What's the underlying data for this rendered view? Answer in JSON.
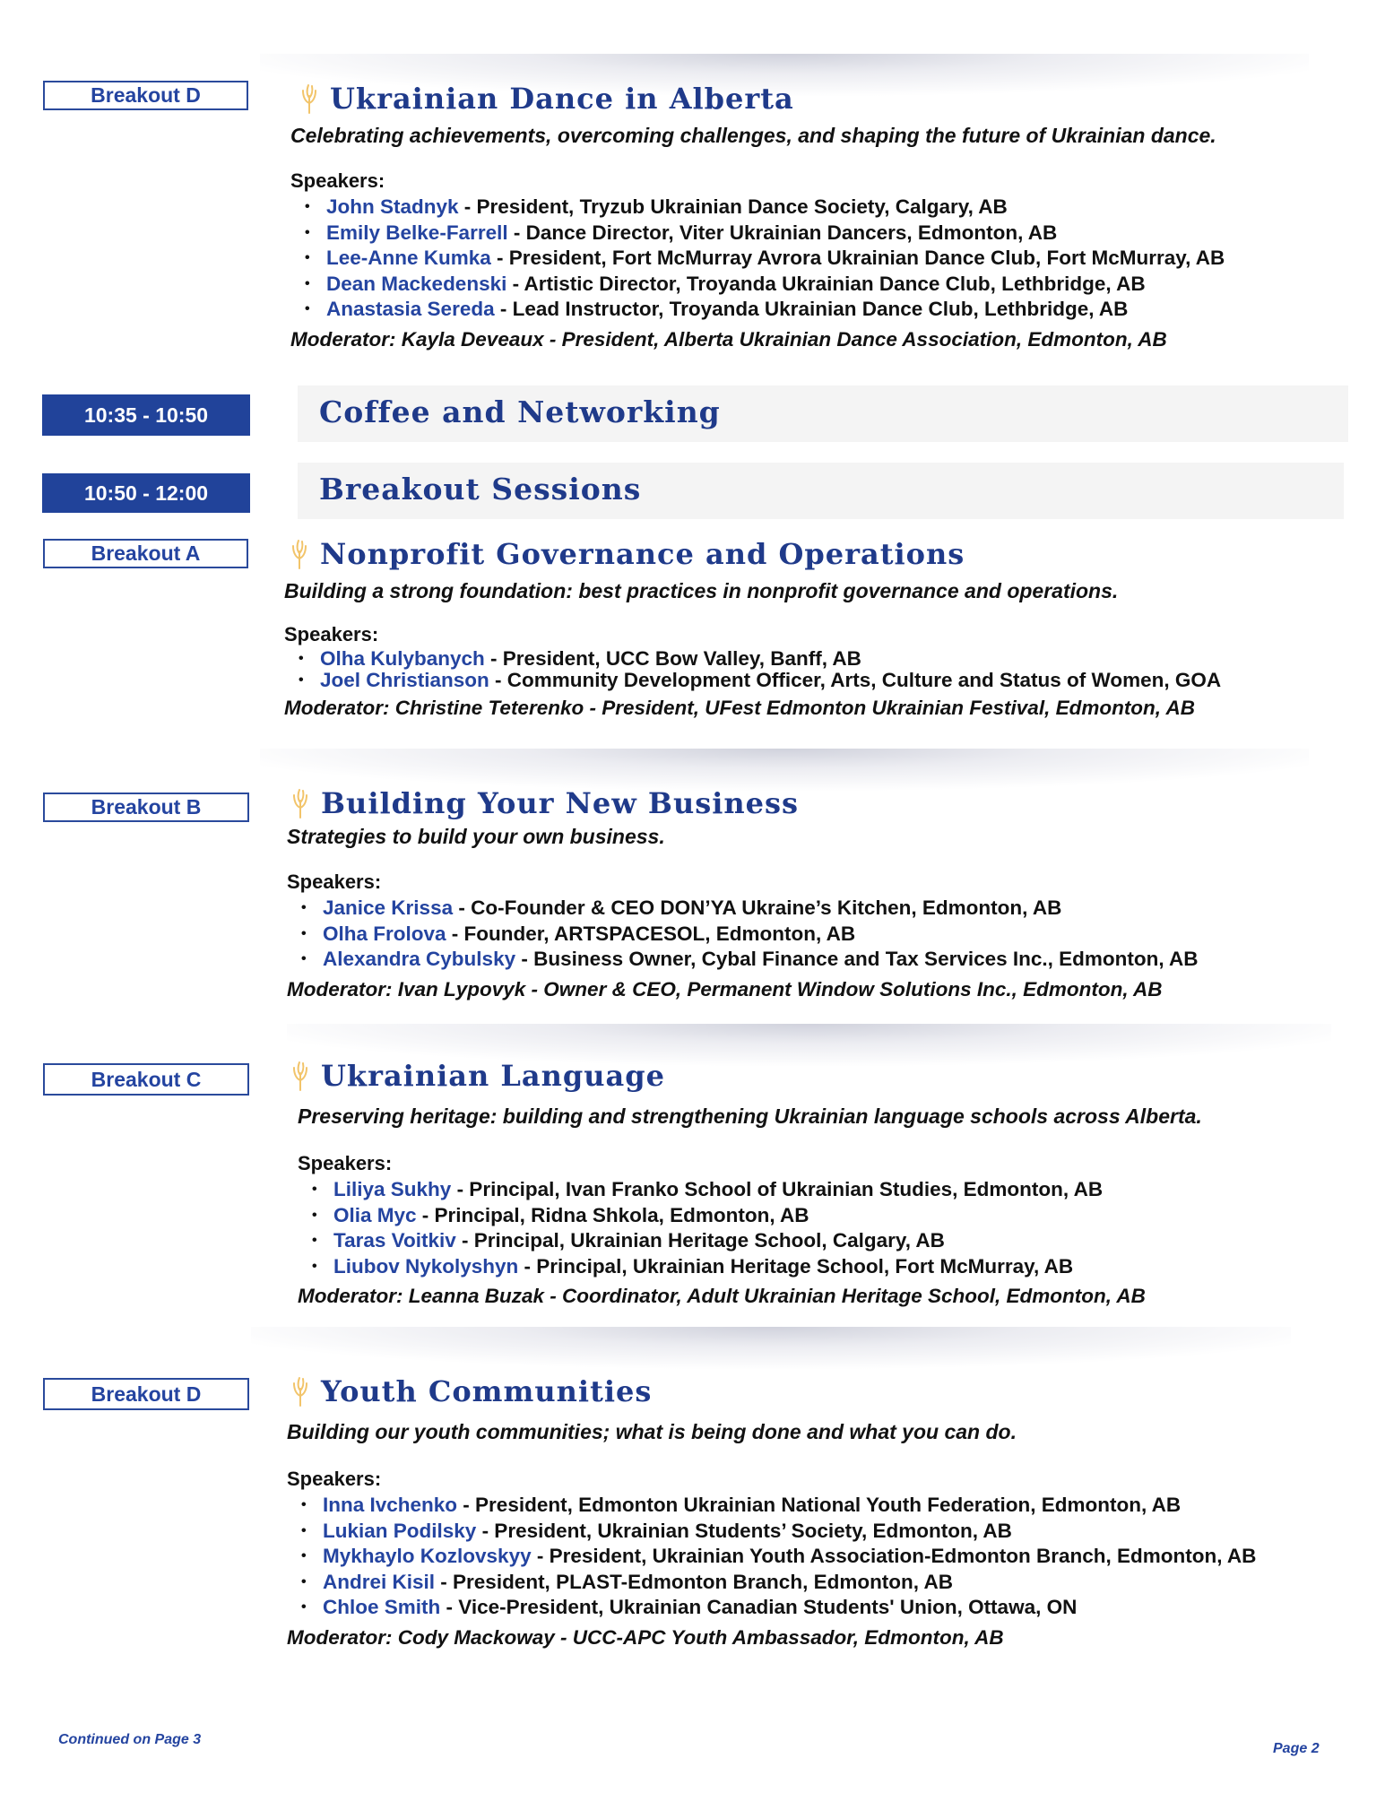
{
  "schedule": [
    {
      "type": "time",
      "time": "10:35 - 10:50",
      "title": "Coffee and Networking"
    },
    {
      "type": "time",
      "time": "10:50 - 12:00",
      "title": "Breakout Sessions"
    }
  ],
  "sessions": [
    {
      "tag": "Breakout D",
      "icon": "wheat-icon",
      "title": "Ukrainian Dance in Alberta",
      "description": "Celebrating achievements, overcoming challenges, and shaping the future of Ukrainian dance.",
      "speakers_label": "Speakers:",
      "speakers": [
        {
          "name": "John Stadnyk",
          "role": " - President, Tryzub Ukrainian Dance Society, Calgary, AB"
        },
        {
          "name": "Emily Belke-Farrell",
          "role": " - Dance Director, Viter Ukrainian Dancers, Edmonton, AB"
        },
        {
          "name": "Lee-Anne Kumka",
          "role": " - President, Fort McMurray Avrora Ukrainian Dance Club, Fort McMurray, AB"
        },
        {
          "name": "Dean Mackedenski",
          "role": " - Artistic Director, Troyanda Ukrainian Dance Club, Lethbridge, AB"
        },
        {
          "name": "Anastasia Sereda",
          "role": " - Lead Instructor, Troyanda Ukrainian Dance Club, Lethbridge, AB"
        }
      ],
      "moderator": "Moderator: Kayla Deveaux - President, Alberta Ukrainian Dance Association, Edmonton, AB"
    },
    {
      "tag": "Breakout A",
      "icon": "wheat-icon",
      "title": "Nonprofit Governance and Operations",
      "description": "Building a strong foundation: best practices in nonprofit governance and operations.",
      "speakers_label": "Speakers:",
      "speakers": [
        {
          "name": "Olha Kulybanych",
          "role": " - President, UCC Bow Valley, Banff, AB"
        },
        {
          "name": "Joel Christianson",
          "role": " - Community Development Officer, Arts, Culture and Status of Women, GOA"
        }
      ],
      "moderator": "Moderator: Christine Teterenko - President, UFest Edmonton Ukrainian Festival, Edmonton, AB"
    },
    {
      "tag": "Breakout B",
      "icon": "wheat-icon",
      "title": "Building Your New Business",
      "description": "Strategies to build your own business.",
      "speakers_label": "Speakers:",
      "speakers": [
        {
          "name": "Janice Krissa",
          "role": " - Co-Founder & CEO DON’YA Ukraine’s Kitchen, Edmonton, AB"
        },
        {
          "name": "Olha Frolova",
          "role": " - Founder, ARTSPACESOL, Edmonton, AB"
        },
        {
          "name": "Alexandra Cybulsky",
          "role": " - Business Owner, Cybal Finance and Tax Services Inc., Edmonton, AB"
        }
      ],
      "moderator": "Moderator: Ivan Lypovyk - Owner & CEO, Permanent Window Solutions Inc., Edmonton, AB"
    },
    {
      "tag": "Breakout C",
      "icon": "wheat-icon",
      "title": "Ukrainian Language",
      "description": "Preserving heritage: building and strengthening Ukrainian language schools across Alberta.",
      "speakers_label": "Speakers:",
      "speakers": [
        {
          "name": "Liliya Sukhy",
          "role": " - Principal, Ivan Franko School of Ukrainian Studies, Edmonton, AB"
        },
        {
          "name": "Olia Myc",
          "role": " - Principal, Ridna Shkola, Edmonton, AB"
        },
        {
          "name": "Taras Voitkiv",
          "role": " - Principal, Ukrainian Heritage School, Calgary, AB"
        },
        {
          "name": "Liubov Nykolyshyn",
          "role": " - Principal, Ukrainian Heritage School, Fort McMurray, AB"
        }
      ],
      "moderator": "Moderator: Leanna Buzak - Coordinator, Adult Ukrainian Heritage School, Edmonton, AB"
    },
    {
      "tag": "Breakout D",
      "icon": "wheat-icon",
      "title": "Youth Communities",
      "description": "Building our youth communities; what is being done and what you can do.",
      "speakers_label": "Speakers:",
      "speakers": [
        {
          "name": "Inna Ivchenko",
          "role": " - President, Edmonton Ukrainian National Youth Federation, Edmonton, AB"
        },
        {
          "name": "Lukian Podilsky",
          "role": " - President, Ukrainian Students’ Society, Edmonton, AB"
        },
        {
          "name": "Mykhaylo Kozlovskyy",
          "role": " - President, Ukrainian Youth Association-Edmonton Branch, Edmonton, AB"
        },
        {
          "name": "Andrei Kisil",
          "role": " - President, PLAST-Edmonton Branch, Edmonton, AB"
        },
        {
          "name": "Chloe Smith",
          "role": " - Vice-President, Ukrainian Canadian Students' Union, Ottawa, ON"
        }
      ],
      "moderator": "Moderator: Cody Mackoway - UCC-APC Youth Ambassador, Edmonton, AB"
    }
  ],
  "footer": {
    "continued": "Continued on Page 3",
    "page": "Page 2"
  },
  "colors": {
    "accent_blue": "#21439a",
    "title_navy": "#1f3a8a",
    "name_blue": "#2444a0",
    "wheat_gold": "#f2c46a",
    "band_gray": "#f4f4f4"
  }
}
